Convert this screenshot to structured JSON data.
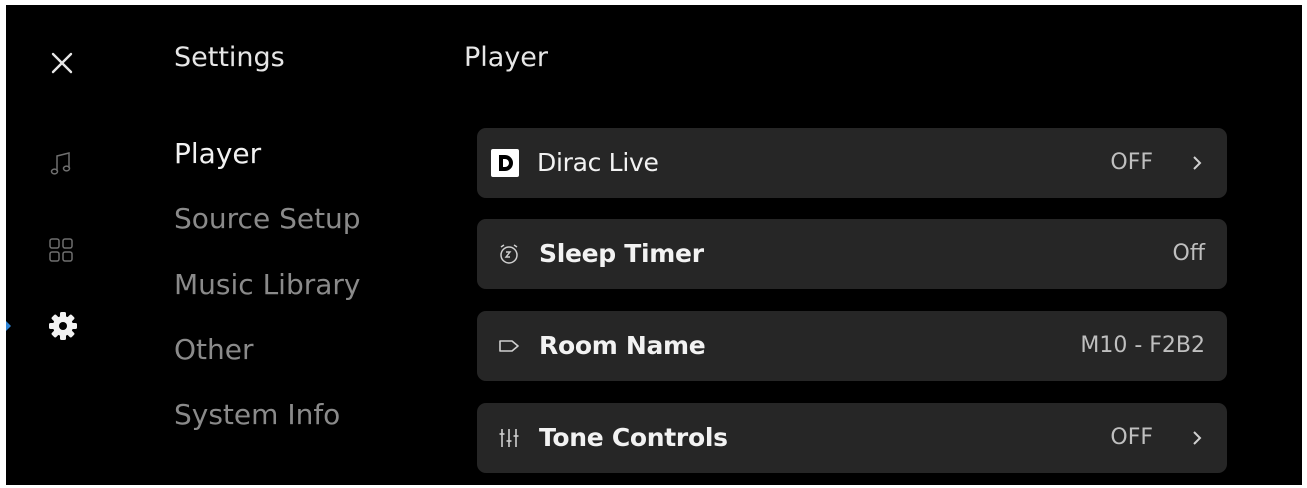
{
  "sidebar": {
    "close_icon": "close-icon",
    "rail": [
      {
        "icon": "music-note-icon",
        "active": false
      },
      {
        "icon": "grid-icon",
        "active": false
      },
      {
        "icon": "gear-icon",
        "active": true
      }
    ]
  },
  "settings": {
    "title": "Settings",
    "items": [
      "Player",
      "Source Setup",
      "Music Library",
      "Other",
      "System Info"
    ],
    "active_index": 0
  },
  "player": {
    "title": "Player",
    "rows": [
      {
        "label": "Dirac Live",
        "value": "OFF",
        "icon": "dirac-logo-icon",
        "chevron": true
      },
      {
        "label": "Sleep Timer",
        "value": "Off",
        "icon": "sleep-timer-icon",
        "chevron": false
      },
      {
        "label": "Room Name",
        "value": "M10 - F2B2",
        "icon": "tag-icon",
        "chevron": false
      },
      {
        "label": "Tone Controls",
        "value": "OFF",
        "icon": "sliders-icon",
        "chevron": true
      }
    ]
  },
  "colors": {
    "background": "#000000",
    "row_background": "#262626",
    "active_text": "#f2f2f2",
    "inactive_text": "#8a8a8a",
    "accent": "#2e84d6"
  }
}
